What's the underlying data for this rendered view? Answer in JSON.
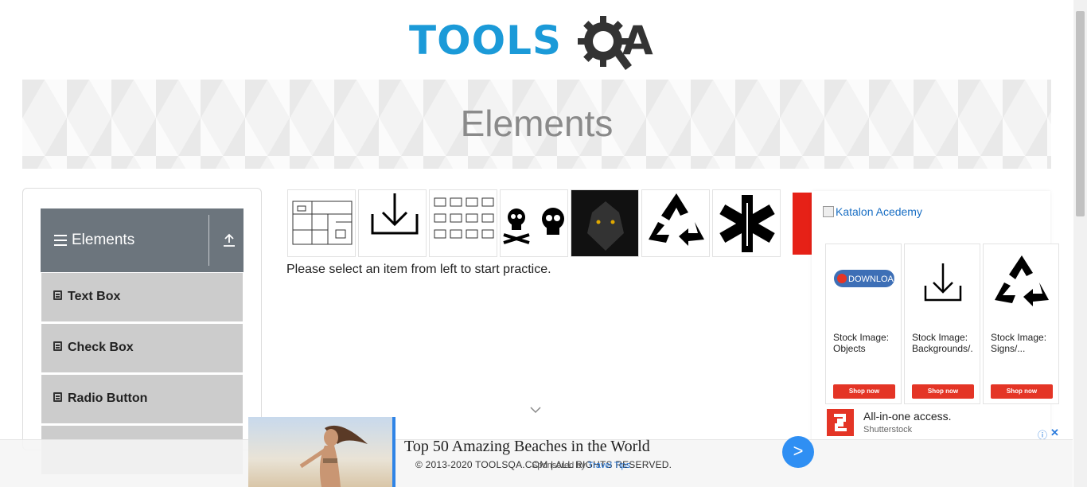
{
  "header": {
    "logo_text": "TOOLS",
    "logo_text_end": "A"
  },
  "banner": {
    "title": "Elements"
  },
  "sidebar": {
    "group": {
      "title": "Elements"
    },
    "items": [
      {
        "label": "Text Box"
      },
      {
        "label": "Check Box"
      },
      {
        "label": "Radio Button"
      }
    ]
  },
  "main": {
    "practice_text": "Please select an item from left to start practice."
  },
  "side_ad": {
    "link_text": "Katalon Acedemy",
    "cards": [
      {
        "caption": "Stock Image: Objects",
        "shop_label": "Shop now",
        "image_label": "DOWNLOAD"
      },
      {
        "caption": "Stock Image: Backgrounds/.",
        "shop_label": "Shop now"
      },
      {
        "caption": "Stock Image: Signs/...",
        "shop_label": "Shop now"
      }
    ],
    "brand_title": "All-in-one access.",
    "brand_name": "Shutterstock",
    "info_icon": "ⓘ",
    "close_icon": "✕"
  },
  "footer": {
    "copyright": "© 2013-2020 TOOLSQA.COM | ALL RIGHTS RESERVED."
  },
  "bottom_ad": {
    "headline": "Top 50 Amazing Beaches in the World",
    "sponsor_prefix": "Sponsored by",
    "sponsor_name": "Travel Tips",
    "arrow": ">"
  },
  "colors": {
    "brand_blue": "#1b9ad8",
    "menu_header": "#6c757d",
    "menu_item": "#cccccc",
    "shop_red": "#e43526"
  }
}
